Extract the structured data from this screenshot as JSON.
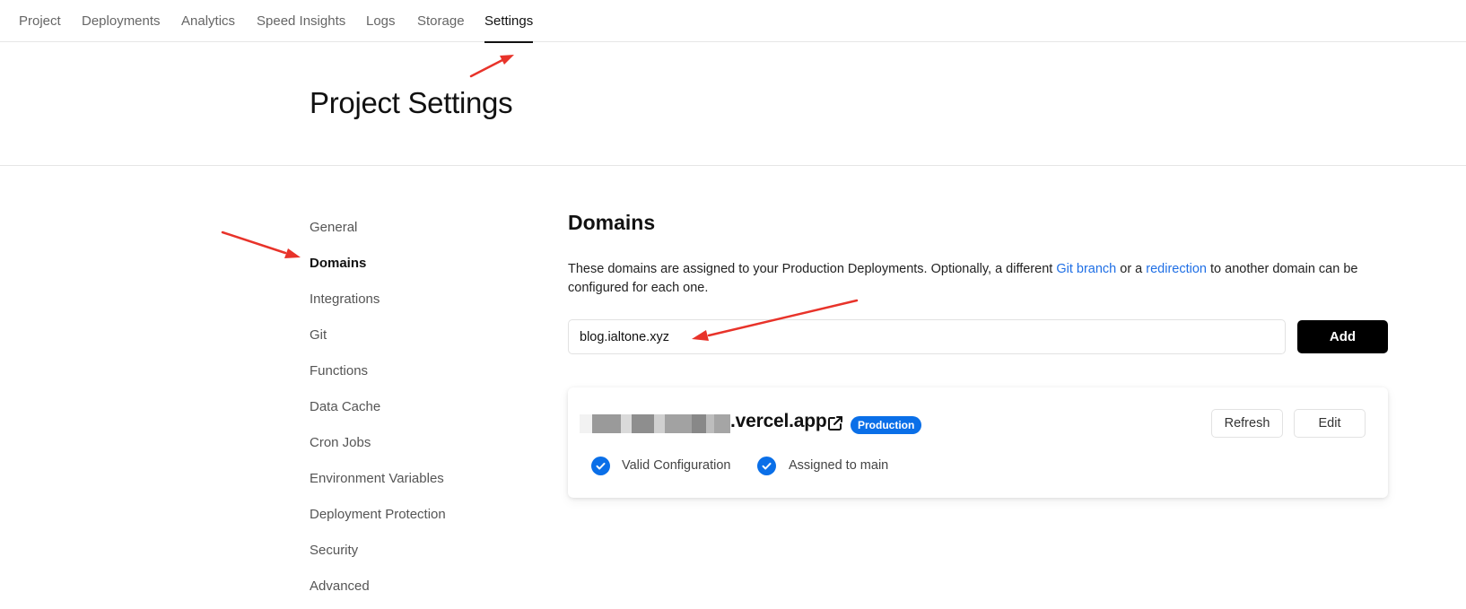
{
  "nav": {
    "tabs": [
      {
        "label": "Project"
      },
      {
        "label": "Deployments"
      },
      {
        "label": "Analytics"
      },
      {
        "label": "Speed Insights"
      },
      {
        "label": "Logs"
      },
      {
        "label": "Storage"
      },
      {
        "label": "Settings",
        "active": true
      }
    ]
  },
  "header": {
    "title": "Project Settings"
  },
  "sidebar": {
    "items": [
      {
        "label": "General"
      },
      {
        "label": "Domains",
        "active": true
      },
      {
        "label": "Integrations"
      },
      {
        "label": "Git"
      },
      {
        "label": "Functions"
      },
      {
        "label": "Data Cache"
      },
      {
        "label": "Cron Jobs"
      },
      {
        "label": "Environment Variables"
      },
      {
        "label": "Deployment Protection"
      },
      {
        "label": "Security"
      },
      {
        "label": "Advanced"
      }
    ]
  },
  "domains": {
    "title": "Domains",
    "description_before": "These domains are assigned to your Production Deployments. Optionally, a different ",
    "link_git_branch": "Git branch",
    "description_middle": " or a ",
    "link_redirection": "redirection",
    "description_after": " to another domain can be configured for each one.",
    "input_value": "blog.ialtone.xyz",
    "add_label": "Add",
    "card": {
      "domain_suffix": ".vercel.app",
      "badge": "Production",
      "refresh_label": "Refresh",
      "edit_label": "Edit",
      "checks": [
        {
          "label": "Valid Configuration"
        },
        {
          "label": "Assigned to main"
        }
      ]
    }
  },
  "colors": {
    "accent": "#0a6fe8",
    "link": "#1f6fe5",
    "annotation": "#e8332a"
  },
  "icons": [
    "external-link-icon",
    "check-circle-icon",
    "annotation-arrow"
  ]
}
